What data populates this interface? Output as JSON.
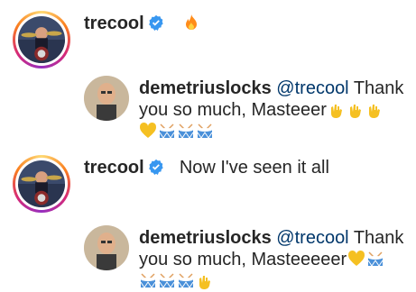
{
  "comments": [
    {
      "username": "trecool",
      "verified": true,
      "text": "",
      "emojis": [
        "fire"
      ],
      "avatar": "drummer-avatar"
    },
    {
      "username": "demetriuslocks",
      "mention": "@trecool",
      "text_line1": " Thank",
      "text_line2": "you so much, Masteeer",
      "emojis_line2": [
        "rock-hand",
        "rock-hand",
        "rock-hand"
      ],
      "emojis_line3": [
        "yellow-heart",
        "drum",
        "drum",
        "drum"
      ],
      "avatar": "man-avatar"
    },
    {
      "username": "trecool",
      "verified": true,
      "text": "Now I've seen it all",
      "avatar": "drummer-avatar"
    },
    {
      "username": "demetriuslocks",
      "mention": "@trecool",
      "text_line1": " Thank",
      "text_line2": "you so much, Masteeeeer",
      "emojis_line2": [
        "yellow-heart",
        "drum"
      ],
      "emojis_line3": [
        "drum",
        "drum",
        "drum",
        "rock-hand"
      ],
      "avatar": "man-avatar"
    }
  ],
  "colors": {
    "verified": "#3897f0",
    "mention": "#00376b",
    "text": "#262626"
  }
}
